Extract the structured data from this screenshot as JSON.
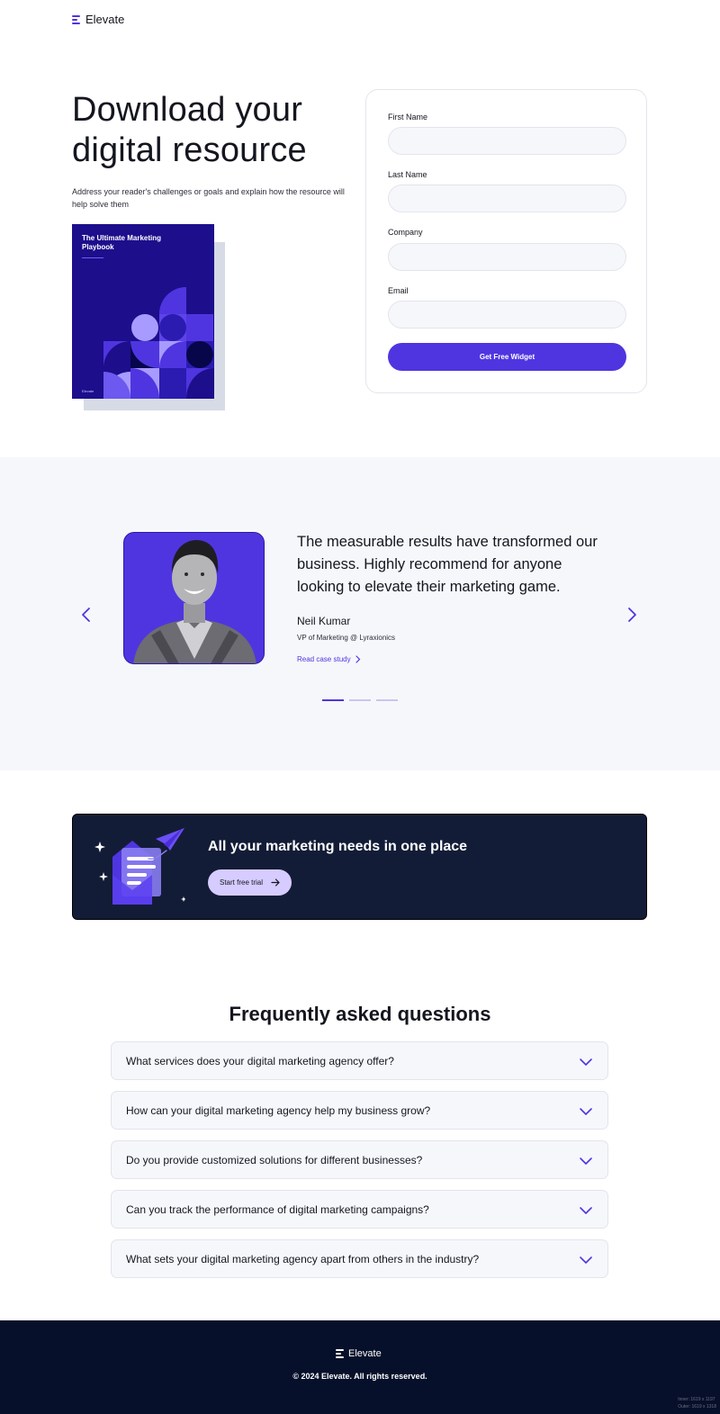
{
  "header": {
    "logo_text": "Elevate"
  },
  "hero": {
    "title": "Download your digital resource",
    "description": "Address your reader's challenges or goals and explain how the resource will help solve them",
    "book": {
      "title": "The Ultimate Marketing Playbook",
      "brand": "Elevate"
    }
  },
  "form": {
    "fields": [
      {
        "label": "First Name",
        "value": ""
      },
      {
        "label": "Last Name",
        "value": ""
      },
      {
        "label": "Company",
        "value": ""
      },
      {
        "label": "Email",
        "value": ""
      }
    ],
    "submit_label": "Get Free Widget"
  },
  "testimonial": {
    "quote": "The measurable results have transformed our business. Highly recommend for anyone looking to elevate their marketing game.",
    "author": "Neil Kumar",
    "role": "VP of Marketing @ Lyraxionics",
    "link_label": "Read case study",
    "slides_total": 3,
    "active_slide": 1
  },
  "cta": {
    "title": "All your marketing needs in one place",
    "button_label": "Start free trial"
  },
  "faq": {
    "title": "Frequently asked questions",
    "items": [
      {
        "question": "What services does your digital marketing agency offer?"
      },
      {
        "question": "How can your digital marketing agency help my business grow?"
      },
      {
        "question": "Do you provide customized solutions for different businesses?"
      },
      {
        "question": "Can you track the performance of digital marketing campaigns?"
      },
      {
        "question": "What sets your digital marketing agency apart from others in the industry?"
      }
    ]
  },
  "footer": {
    "logo_text": "Elevate",
    "copyright": "© 2024 Elevate. All rights reserved.",
    "viewport_inner": "Inner: 1619 x 1197",
    "viewport_outer": "Outer: 1619 x 1318"
  },
  "colors": {
    "accent": "#4f35e0",
    "navy": "#131c37",
    "footer": "#07102a",
    "surface": "#f6f7fb"
  }
}
